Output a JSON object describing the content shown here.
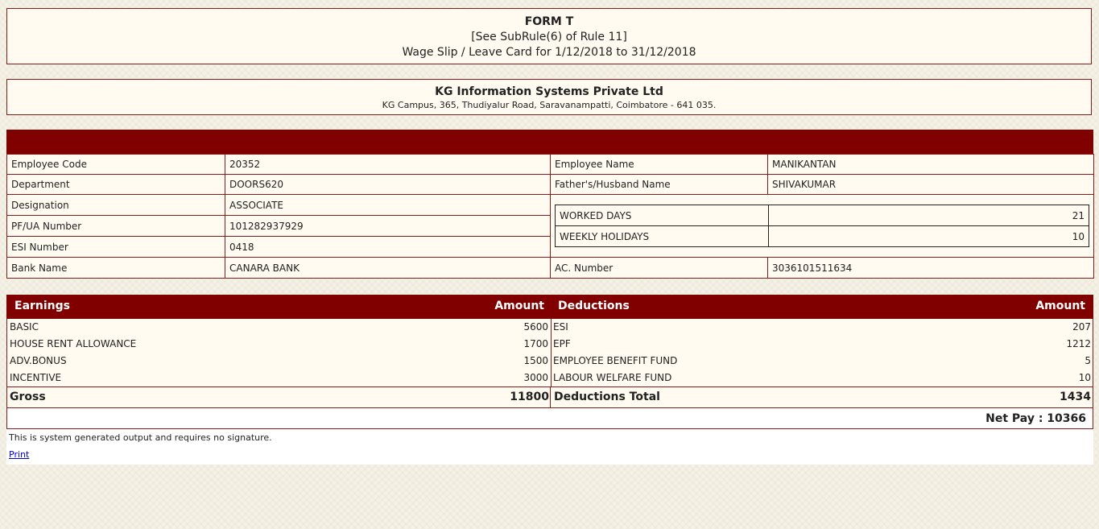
{
  "form": {
    "title": "FORM T",
    "rule": "[See SubRule(6) of Rule 11]",
    "period": "Wage Slip / Leave Card for 1/12/2018 to 31/12/2018"
  },
  "company": {
    "name": "KG Information Systems Private Ltd",
    "address": "KG Campus, 365, Thudiyalur Road, Saravanampatti, Coimbatore - 641 035."
  },
  "employee": {
    "code_label": "Employee Code",
    "code": "20352",
    "name_label": "Employee Name",
    "name": "MANIKANTAN",
    "dept_label": "Department",
    "dept": "DOORS620",
    "father_label": "Father's/Husband Name",
    "father": "SHIVAKUMAR",
    "desig_label": "Designation",
    "desig": "ASSOCIATE",
    "pf_label": "PF/UA Number",
    "pf": "101282937929",
    "esi_label": "ESI Number",
    "esi": "0418",
    "bank_label": "Bank Name",
    "bank": "CANARA BANK",
    "ac_label": "AC. Number",
    "ac": "3036101511634",
    "worked_label": "WORKED DAYS",
    "worked": "21",
    "weekly_label": "WEEKLY HOLIDAYS",
    "weekly": "10"
  },
  "salary": {
    "earnings_label": "Earnings",
    "amount_label": "Amount",
    "deductions_label": "Deductions",
    "earnings": [
      {
        "name": "BASIC",
        "amount": "5600"
      },
      {
        "name": "HOUSE RENT ALLOWANCE",
        "amount": "1700"
      },
      {
        "name": "ADV.BONUS",
        "amount": "1500"
      },
      {
        "name": "INCENTIVE",
        "amount": "3000"
      }
    ],
    "deductions": [
      {
        "name": "ESI",
        "amount": "207"
      },
      {
        "name": "EPF",
        "amount": "1212"
      },
      {
        "name": "EMPLOYEE BENEFIT FUND",
        "amount": "5"
      },
      {
        "name": "LABOUR WELFARE FUND",
        "amount": "10"
      }
    ],
    "gross_label": "Gross",
    "gross": "11800",
    "ded_total_label": "Deductions Total",
    "ded_total": "1434",
    "net_pay": "Net Pay : 10366"
  },
  "footer": {
    "note": "This is system generated output and requires no signature.",
    "print": "Print"
  }
}
